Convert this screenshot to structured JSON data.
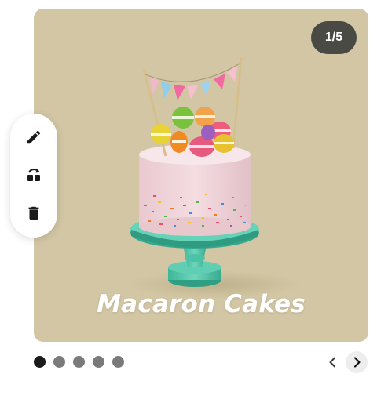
{
  "carousel": {
    "counter": "1/5",
    "caption": "Macaron Cakes",
    "slide_count": 5,
    "active_index": 0,
    "background_color": "#d2c6a4"
  },
  "toolbar": {
    "icons": [
      "pencil-icon",
      "swap-icon",
      "trash-icon"
    ]
  },
  "pagination": {
    "dots": [
      "1",
      "2",
      "3",
      "4",
      "5"
    ]
  },
  "navigation": {
    "prev_icon": "chevron-left-icon",
    "next_icon": "chevron-right-icon"
  }
}
